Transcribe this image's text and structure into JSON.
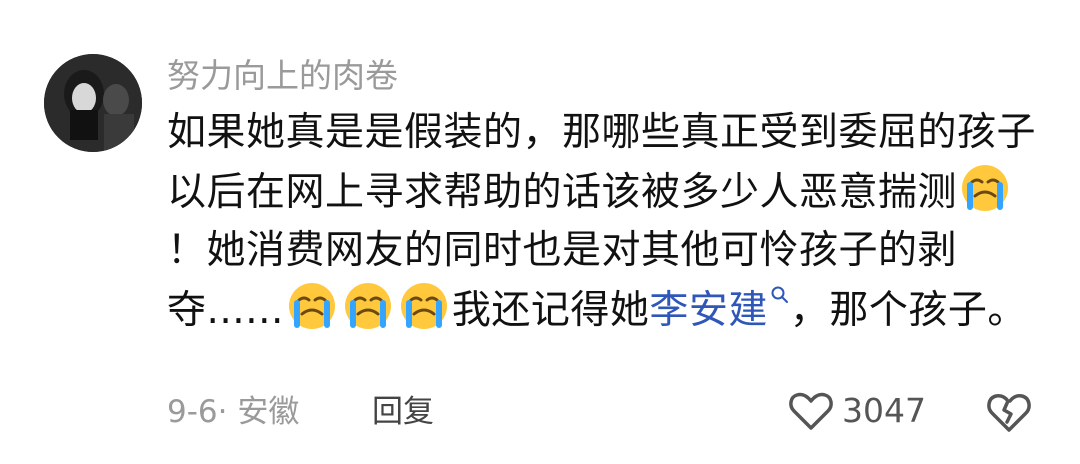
{
  "comment": {
    "username": "努力向上的肉卷",
    "text_part1": "如果她真是是假装的，那哪些真正受到委屈的孩子以后在网上寻求帮助的话该被多少人恶意揣测",
    "text_part2": "！她消费网友的同时也是对其他可怜孩子的剥夺......",
    "text_part3": "我还记得她",
    "mention": "李安建",
    "text_part4": "，那个孩子。",
    "date_location": "9-6· 安徽",
    "reply_label": "回复",
    "like_count": "3047"
  },
  "icons": {
    "emoji": "crying-face-emoji",
    "mention_search": "search-icon",
    "like": "heart-outline-icon",
    "dislike": "broken-heart-icon"
  },
  "colors": {
    "username": "#9a9a9a",
    "mention": "#2f57b8",
    "text": "#111111"
  }
}
